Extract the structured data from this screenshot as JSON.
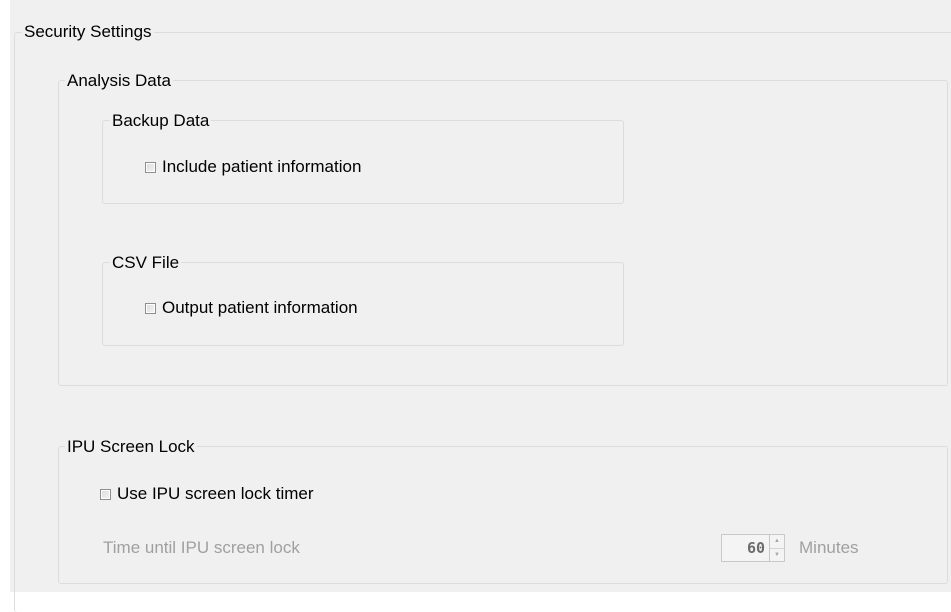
{
  "security_settings": {
    "title": "Security Settings",
    "analysis_data": {
      "title": "Analysis Data",
      "backup_data": {
        "title": "Backup Data",
        "include_patient_info": {
          "label": "Include patient information",
          "checked": false
        }
      },
      "csv_file": {
        "title": "CSV File",
        "output_patient_info": {
          "label": "Output patient information",
          "checked": false
        }
      }
    },
    "ipu_screen_lock": {
      "title": "IPU Screen Lock",
      "use_timer": {
        "label": "Use IPU screen lock timer",
        "checked": false
      },
      "time_until_lock": {
        "label": "Time until IPU screen lock",
        "value": "60",
        "unit": "Minutes",
        "enabled": false
      }
    }
  },
  "icons": {
    "spin_up": "triangle-up",
    "spin_down": "triangle-down"
  }
}
